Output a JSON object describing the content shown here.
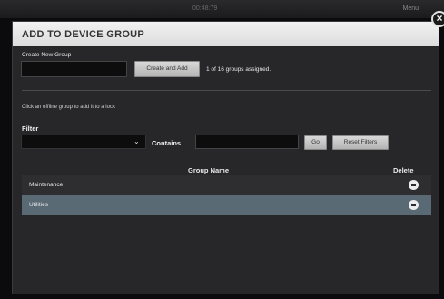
{
  "background": {
    "center_text": "00:48:79",
    "right_text": "Menu"
  },
  "modal": {
    "title": "ADD TO DEVICE GROUP",
    "close_icon": "×",
    "create_label": "Create New Group",
    "create_placeholder": "",
    "create_button": "Create and Add",
    "assigned_text": "1 of 16 groups assigned.",
    "hint": "Click an offline group to add it to a lock",
    "filter_label": "Filter",
    "filter_selected": "",
    "contains_label": "Contains",
    "contains_value": "",
    "go_button": "Go",
    "reset_button": "Reset Filters",
    "table": {
      "columns": [
        "Group Name",
        "Delete"
      ],
      "rows": [
        {
          "name": "Maintenance"
        },
        {
          "name": "Utilities"
        }
      ]
    }
  },
  "colors": {
    "selected_row": "#5a6a74",
    "modal_bg": "#272729",
    "header_bg": "#e6e6e6"
  }
}
